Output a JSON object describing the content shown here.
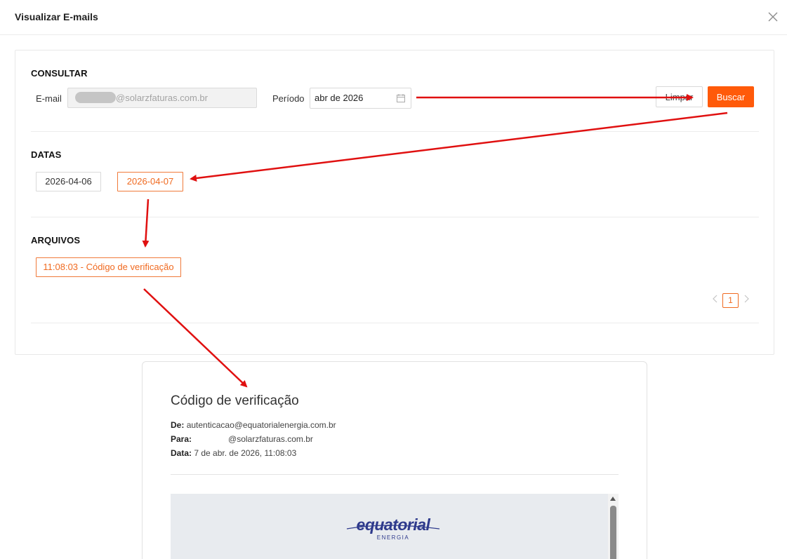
{
  "modal": {
    "title": "Visualizar E-mails"
  },
  "consultar": {
    "title": "CONSULTAR",
    "email_label": "E-mail",
    "email_value_suffix": "@solarzfaturas.com.br",
    "period_label": "Período",
    "period_value": "abr de 2026",
    "clear_label": "Limpar",
    "search_label": "Buscar"
  },
  "datas": {
    "title": "DATAS",
    "items": [
      {
        "label": "2026-04-06",
        "active": false
      },
      {
        "label": "2026-04-07",
        "active": true
      }
    ]
  },
  "arquivos": {
    "title": "ARQUIVOS",
    "items": [
      {
        "label": "11:08:03 - Código de verificação",
        "active": true
      }
    ]
  },
  "pagination": {
    "current_page": "1"
  },
  "preview": {
    "subject": "Código de verificação",
    "from_label": "De:",
    "from_value": "autenticacao@equatorialenergia.com.br",
    "to_label": "Para:",
    "to_value": "@solarzfaturas.com.br",
    "date_label": "Data:",
    "date_value": "7 de abr. de 2026, 11:08:03",
    "logo_text": "equatorial",
    "logo_subtext": "ENERGIA"
  },
  "colors": {
    "accent": "#ff5a0a",
    "annotation_arrow": "#e01010"
  },
  "icons": [
    "close-icon",
    "calendar-icon",
    "chevron-left-icon",
    "chevron-right-icon"
  ]
}
